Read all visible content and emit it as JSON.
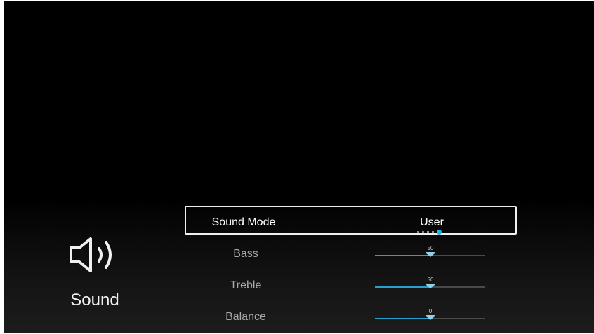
{
  "category": {
    "label": "Sound",
    "icon": "speaker-icon"
  },
  "rows": {
    "sound_mode": {
      "label": "Sound Mode",
      "value": "User",
      "option_count": 5,
      "selected_index": 4
    },
    "bass": {
      "label": "Bass",
      "value": "50",
      "level": 0.5
    },
    "treble": {
      "label": "Treble",
      "value": "50",
      "level": 0.5
    },
    "balance": {
      "label": "Balance",
      "value": "0",
      "level": 0.5
    }
  },
  "colors": {
    "accent": "#29b6e6",
    "slider_fill": "#2a9fcf",
    "background": "#000000"
  }
}
